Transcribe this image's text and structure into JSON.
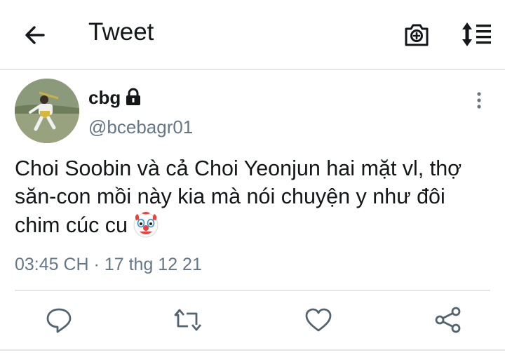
{
  "header": {
    "title": "Tweet",
    "icons": [
      "back-arrow-icon",
      "camera-icon",
      "sort-icon"
    ]
  },
  "tweet": {
    "display_name": "cbg",
    "handle": "@bcebagr01",
    "text": "Choi Soobin và cả Choi Yeonjun hai mặt vl, thợ săn-con mồi này kia mà nói chuyện y như đôi chim cúc cu",
    "emoji": "clown-face",
    "timestamp": "03:45 CH · 17 thg 12 21",
    "protected": true
  },
  "actions": [
    "reply",
    "retweet",
    "like",
    "share"
  ],
  "colors": {
    "text": "#14171a",
    "secondary": "#657786",
    "divider": "#e3e6e8",
    "icon": "#536471"
  }
}
